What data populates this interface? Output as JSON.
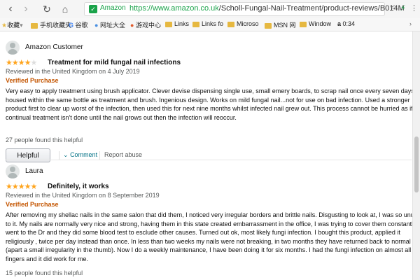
{
  "browser": {
    "site_name": "Amazon",
    "url_host": "https://www.amazon.co.uk",
    "url_path": "/Scholl-Fungal-Nail-Treatment/product-reviews/B014M",
    "icons": [
      "back-icon",
      "forward-icon",
      "reload-icon",
      "home-icon",
      "star-icon",
      "shield-icon",
      "share-icon",
      "lightning-icon"
    ]
  },
  "bookmarks": [
    {
      "label": "收藏",
      "icon": "star-icon"
    },
    {
      "label": "手机收藏夹",
      "icon": "folder-icon"
    },
    {
      "label": "谷歌",
      "icon": "google-icon"
    },
    {
      "label": "网址大全",
      "icon": "globe-icon"
    },
    {
      "label": "游戏中心",
      "icon": "gamepad-icon"
    },
    {
      "label": "Links",
      "icon": "folder-icon"
    },
    {
      "label": "Links fo",
      "icon": "folder-icon"
    },
    {
      "label": "Microso",
      "icon": "folder-icon"
    },
    {
      "label": "MSN 网",
      "icon": "folder-icon"
    },
    {
      "label": "Window",
      "icon": "folder-icon"
    },
    {
      "label": "0:34",
      "icon": "amazon-icon"
    }
  ],
  "reviews": [
    {
      "author": "Amazon Customer",
      "rating": 4,
      "rating_max": 5,
      "title": "Treatment for mild fungal nail infections",
      "meta": "Reviewed in the United Kingdom on 4 July 2019",
      "verified": "Verified Purchase",
      "body_lines": [
        "Very easy to apply treatment using brush applicator. Clever devise dispensing single use, small emery boards, to scrap nail once every seven days,",
        "housed within the same bottle as treatment and brush. Ingenious design. Works on mild fungal nail...not for use on bad infection. Used a stronger",
        "product first to clear up worst of the infection, then used this for next nine months whilst infected nail grew out. This process cannot be hurried as if",
        "continual treatment isn't done until the nail grows out then the infection will reoccur."
      ],
      "helpful_count": "27 people found this helpful",
      "helpful_button": "Helpful",
      "comment": "Comment",
      "report": "Report abuse"
    },
    {
      "author": "Laura",
      "rating": 5,
      "rating_max": 5,
      "title": "Definitely, it works",
      "meta": "Reviewed in the United Kingdom on 8 September 2019",
      "verified": "Verified Purchase",
      "body_lines": [
        "After removing my shellac nails in the same salon that did them, I noticed very irregular borders and brittle nails. Disgusting to look at, I was so unused",
        "to it. My nails are normally very nice and strong, having them in this state created embarrassment in the office, I was trying to cover them constantly. I",
        "went to the Dr and they did some blood test to esclude other causes. Turned out ok, most likely fungi infection. I bought this product, applied it",
        "religiously , twice per day instead than once. In less than two weeks my nails were not breaking, in two months they have returned back to normal",
        "(apart a small irregularity in the thumb). Now I do a weekly maintenance, I have been doing it for six months. I had the fungi infection on almost all",
        "fingers and it did work for me."
      ],
      "helpful_count": "15 people found this helpful"
    }
  ]
}
